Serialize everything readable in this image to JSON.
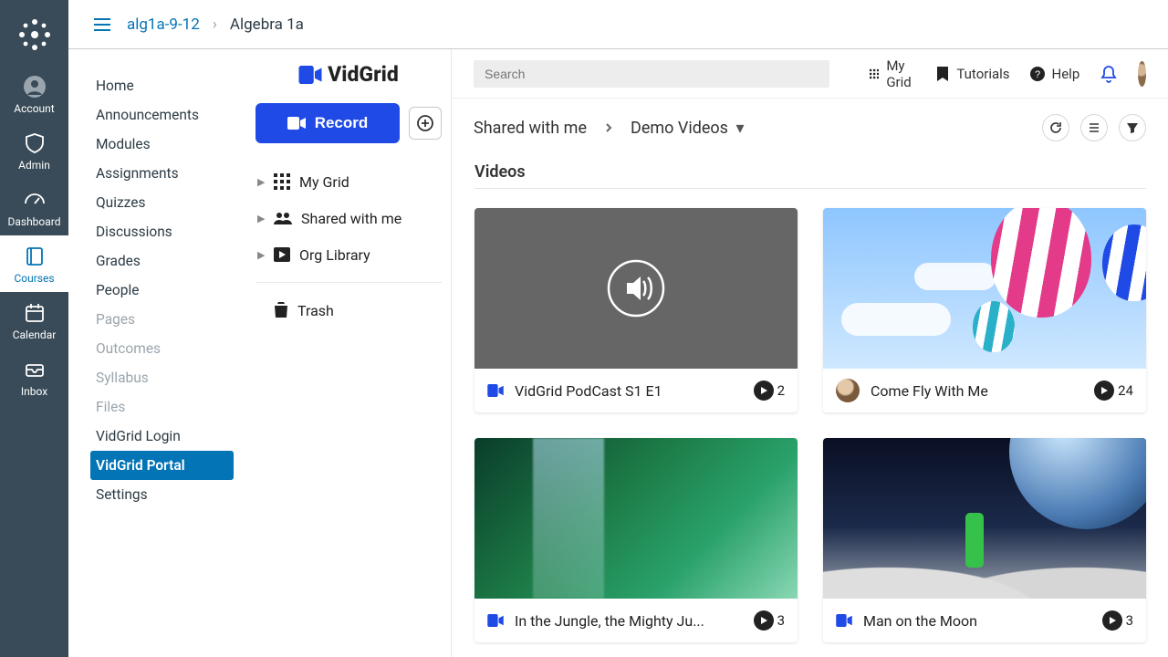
{
  "global_nav": {
    "items": [
      {
        "label": "Account"
      },
      {
        "label": "Admin"
      },
      {
        "label": "Dashboard"
      },
      {
        "label": "Courses"
      },
      {
        "label": "Calendar"
      },
      {
        "label": "Inbox"
      }
    ]
  },
  "breadcrumb": {
    "course_code": "alg1a-9-12",
    "course_name": "Algebra 1a"
  },
  "course_nav": {
    "items": [
      {
        "label": "Home"
      },
      {
        "label": "Announcements"
      },
      {
        "label": "Modules"
      },
      {
        "label": "Assignments"
      },
      {
        "label": "Quizzes"
      },
      {
        "label": "Discussions"
      },
      {
        "label": "Grades"
      },
      {
        "label": "People"
      },
      {
        "label": "Pages"
      },
      {
        "label": "Outcomes"
      },
      {
        "label": "Syllabus"
      },
      {
        "label": "Files"
      },
      {
        "label": "VidGrid Login"
      },
      {
        "label": "VidGrid Portal"
      },
      {
        "label": "Settings"
      }
    ]
  },
  "vidgrid": {
    "brand": "VidGrid",
    "record_label": "Record",
    "tree": {
      "my_grid": "My Grid",
      "shared": "Shared with me",
      "org": "Org Library",
      "trash": "Trash"
    },
    "search_placeholder": "Search",
    "topbar": {
      "my_grid": "My Grid",
      "tutorials": "Tutorials",
      "help": "Help"
    },
    "crumb": {
      "root": "Shared with me",
      "folder": "Demo Videos"
    },
    "section_title": "Videos",
    "videos": [
      {
        "title": "VidGrid PodCast S1 E1",
        "plays": "2",
        "avatar": "logo"
      },
      {
        "title": "Come Fly With Me",
        "plays": "24",
        "avatar": "user"
      },
      {
        "title": "In the Jungle, the Mighty Ju...",
        "plays": "3",
        "avatar": "logo"
      },
      {
        "title": "Man on the Moon",
        "plays": "3",
        "avatar": "logo"
      }
    ]
  }
}
